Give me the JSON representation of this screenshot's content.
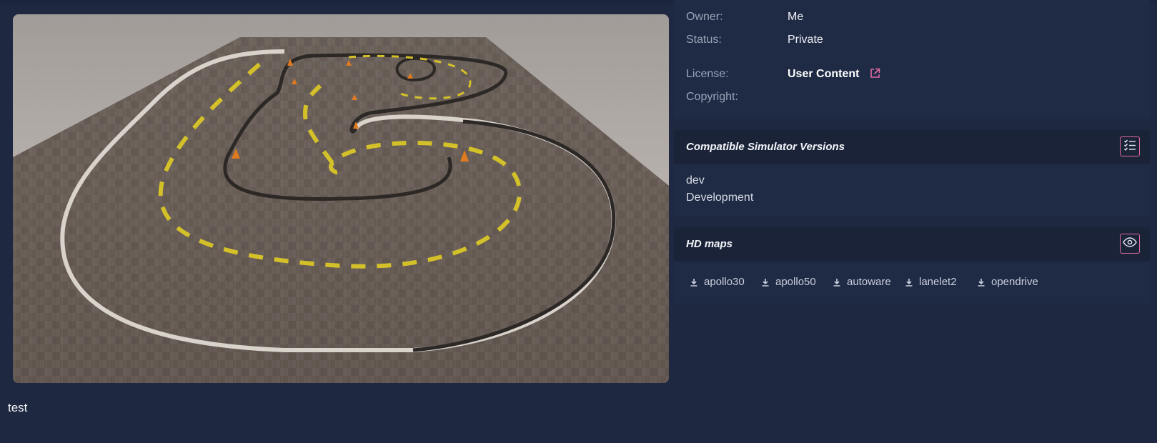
{
  "preview": {
    "image": "track-map-preview",
    "caption": "test"
  },
  "info": {
    "owner_label": "Owner:",
    "owner_value": "Me",
    "status_label": "Status:",
    "status_value": "Private",
    "license_label": "License:",
    "license_value": "User Content",
    "copyright_label": "Copyright:",
    "copyright_value": ""
  },
  "simulators": {
    "title": "Compatible Simulator Versions",
    "icon": "checklist-icon",
    "versions": [
      "dev",
      "Development"
    ]
  },
  "hdmaps": {
    "title": "HD maps",
    "icon": "eye-icon",
    "items": [
      "apollo30",
      "apollo50",
      "autoware",
      "lanelet2",
      "opendrive"
    ]
  },
  "colors": {
    "accent": "#e06aa0",
    "background": "#1e2841",
    "panel": "#1f2a44"
  }
}
